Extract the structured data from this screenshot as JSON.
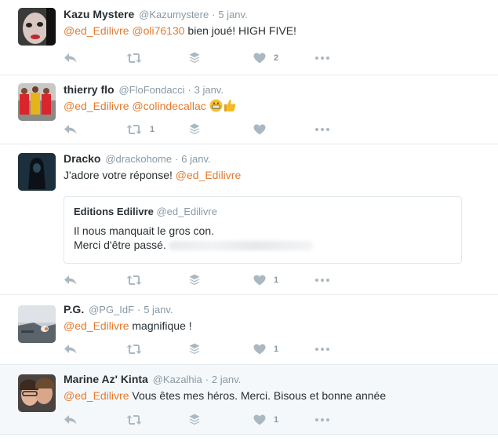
{
  "tweets": [
    {
      "fullname": "Kazu Mystere",
      "username": "@Kazumystere",
      "time": "5 janv.",
      "parts": [
        {
          "type": "mention",
          "text": "@ed_Edilivre"
        },
        {
          "type": "text",
          "text": " "
        },
        {
          "type": "mention",
          "text": "@oli76130"
        },
        {
          "type": "text",
          "text": " bien joué! HIGH FIVE!"
        }
      ],
      "retweet_count": "",
      "like_count": "2"
    },
    {
      "fullname": "thierry flo",
      "username": "@FloFondacci",
      "time": "3 janv.",
      "parts": [
        {
          "type": "mention",
          "text": "@ed_Edilivre"
        },
        {
          "type": "text",
          "text": " "
        },
        {
          "type": "mention",
          "text": "@colindecallac"
        }
      ],
      "emojis": [
        "grinning-face",
        "thumbs-up"
      ],
      "retweet_count": "1",
      "like_count": ""
    },
    {
      "fullname": "Dracko",
      "username": "@drackohome",
      "time": "6 janv.",
      "parts": [
        {
          "type": "text",
          "text": "J'adore votre réponse! "
        },
        {
          "type": "mention",
          "text": "@ed_Edilivre"
        }
      ],
      "quote": {
        "fullname": "Editions Edilivre",
        "username": "@ed_Edilivre",
        "line1": "Il nous manquait le gros con.",
        "line2": "Merci d'être passé."
      },
      "retweet_count": "",
      "like_count": "1"
    },
    {
      "fullname": "P.G.",
      "username": "@PG_IdF",
      "time": "5 janv.",
      "parts": [
        {
          "type": "mention",
          "text": "@ed_Edilivre"
        },
        {
          "type": "text",
          "text": " magnifique !"
        }
      ],
      "retweet_count": "",
      "like_count": "1"
    },
    {
      "fullname": "Marine Az' Kinta",
      "username": "@Kazalhia",
      "time": "2 janv.",
      "parts": [
        {
          "type": "mention",
          "text": "@ed_Edilivre"
        },
        {
          "type": "text",
          "text": " Vous êtes mes héros. Merci. Bisous et bonne année"
        }
      ],
      "retweet_count": "",
      "like_count": "1"
    }
  ],
  "separator": "·",
  "icons": {
    "reply": "reply-icon",
    "retweet": "retweet-icon",
    "stack": "stack-icon",
    "like": "heart-icon",
    "more": "more-icon"
  },
  "colors": {
    "mention": "#e57b2f",
    "icon": "#aab8c2",
    "highlight_bg": "#f5f8fa"
  }
}
